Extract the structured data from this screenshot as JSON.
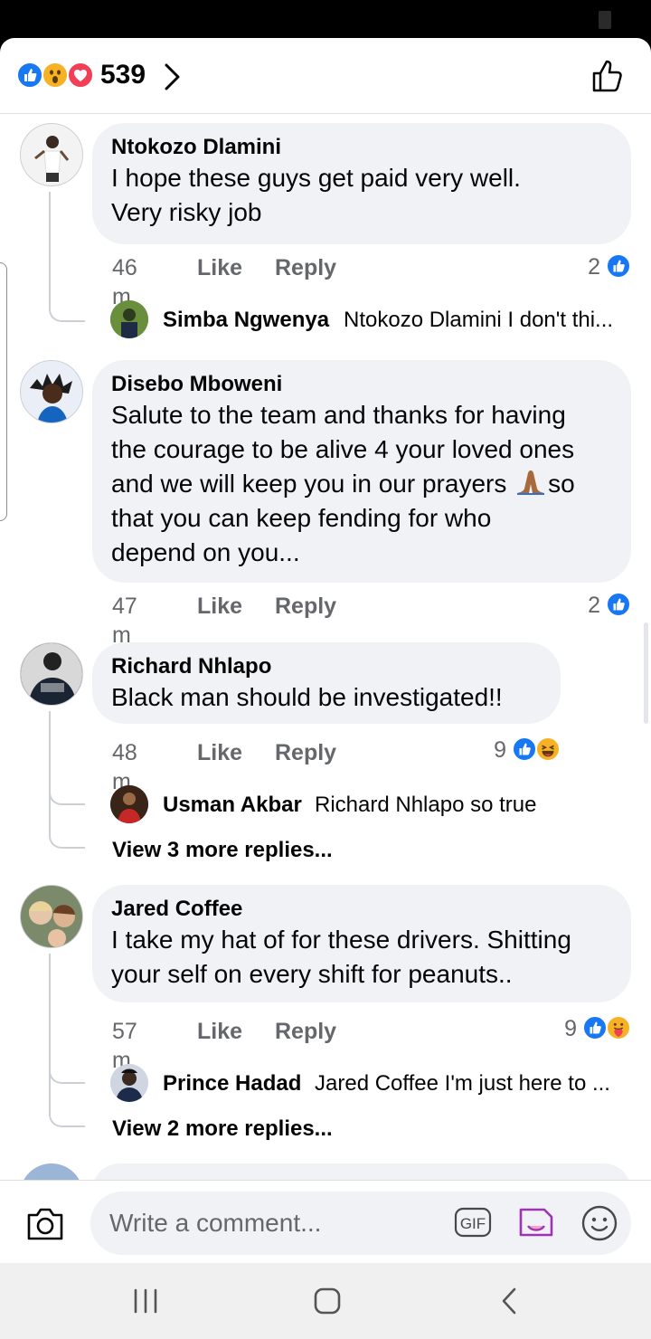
{
  "header": {
    "reaction_icons": [
      "like-icon",
      "wow-icon",
      "love-icon"
    ],
    "reaction_count": "539"
  },
  "composer": {
    "placeholder": "Write a comment...",
    "gif_label": "GIF"
  },
  "comments": [
    {
      "name": "Ntokozo Dlamini",
      "lines": [
        "I hope these guys get paid very well.",
        "Very risky job"
      ],
      "time": "46 m",
      "like": "Like",
      "reply": "Reply",
      "reactions_count": "2",
      "reactions": [
        "like-icon"
      ],
      "reply_preview": {
        "name": "Simba Ngwenya",
        "text": "Ntokozo Dlamini I don't thi..."
      }
    },
    {
      "name": "Disebo Mboweni",
      "lines": [
        "Salute to the team and thanks for having",
        "the courage to be alive 4 your loved ones",
        "and we will keep you in our prayers",
        "that you can keep fending for who",
        "depend on you..."
      ],
      "line3_tail": "so",
      "time": "47 m",
      "like": "Like",
      "reply": "Reply",
      "reactions_count": "2",
      "reactions": [
        "like-icon"
      ]
    },
    {
      "name": "Richard Nhlapo",
      "lines": [
        "Black man should be investigated!!"
      ],
      "time": "48 m",
      "like": "Like",
      "reply": "Reply",
      "reactions_count": "9",
      "reactions": [
        "like-icon",
        "haha-icon"
      ],
      "reply_preview": {
        "name": "Usman Akbar",
        "text": "Richard Nhlapo so true"
      },
      "more_replies": "View 3 more replies..."
    },
    {
      "name": "Jared Coffee",
      "lines": [
        "I take my hat of for these drivers. Shitting",
        "your self on every shift for peanuts.."
      ],
      "time": "57 m",
      "like": "Like",
      "reply": "Reply",
      "reactions_count": "9",
      "reactions": [
        "like-icon",
        "care-icon"
      ],
      "reply_preview": {
        "name": "Prince Hadad",
        "text": "Jared Coffee I'm just here to ..."
      },
      "more_replies": "View 2 more replies..."
    }
  ],
  "colors": {
    "like_blue": "#1877f2",
    "love_red": "#f33e58",
    "emoji_yellow": "#f7b125",
    "bubble_gray": "#f0f2f5",
    "meta_gray": "#65676b"
  }
}
